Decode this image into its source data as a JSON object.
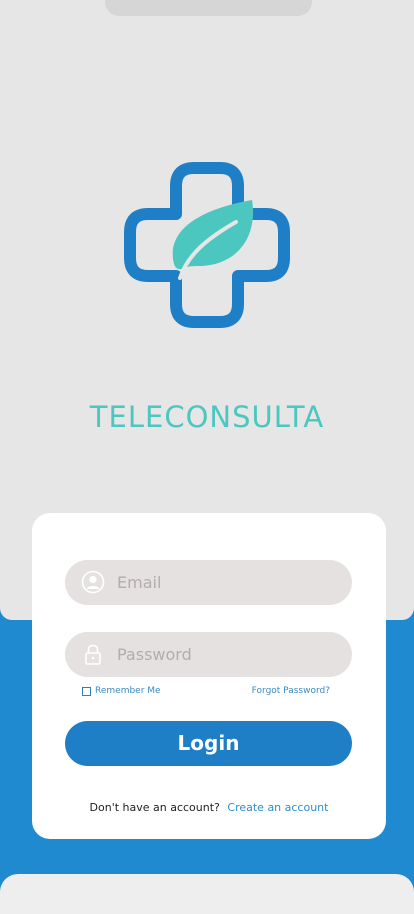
{
  "app": {
    "title": "TELECONSULTA",
    "logo_icon": "medical-cross-leaf-icon"
  },
  "login_form": {
    "email_placeholder": "Email",
    "email_icon": "user-icon",
    "password_placeholder": "Password",
    "password_icon": "lock-icon",
    "remember_label": "Remember Me",
    "remember_checked": false,
    "forgot_label": "Forgot Password?",
    "login_label": "Login",
    "no_account_text": "Don't have an account?",
    "create_account_label": "Create an account"
  },
  "colors": {
    "primary_blue": "#1f7fc6",
    "teal": "#4cc7c0",
    "panel_gray": "#e6e6e6",
    "field_gray": "#e5e1e1"
  }
}
